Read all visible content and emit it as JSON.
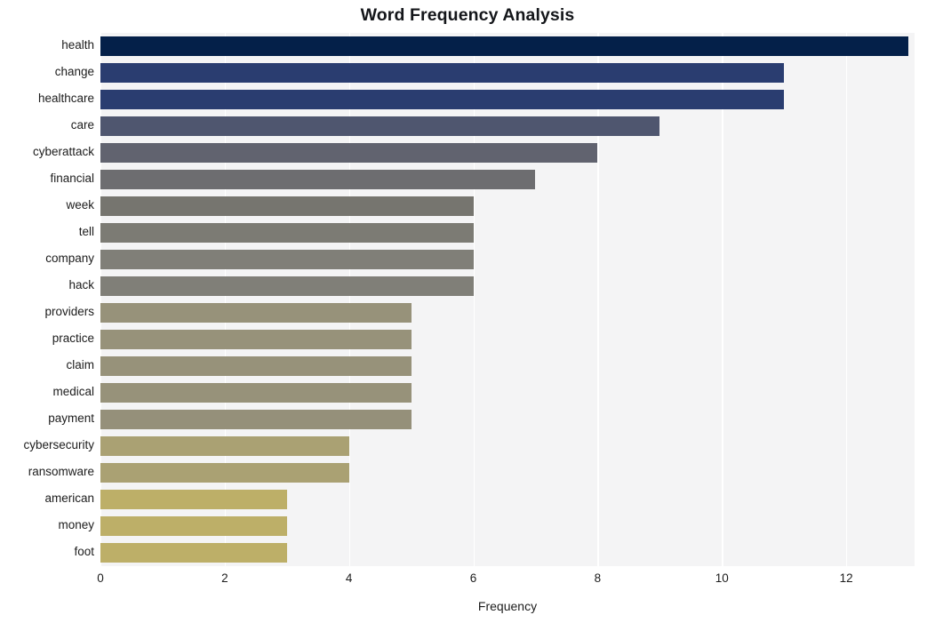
{
  "chart_data": {
    "type": "bar",
    "orientation": "horizontal",
    "title": "Word Frequency Analysis",
    "xlabel": "Frequency",
    "ylabel": "",
    "xlim": [
      0,
      13.1
    ],
    "xticks": [
      "0",
      "2",
      "4",
      "6",
      "8",
      "10",
      "12"
    ],
    "xtick_values": [
      0,
      2,
      4,
      6,
      8,
      10,
      12
    ],
    "grid": "vertical-white-on-light-gray",
    "legend": "none",
    "categories": [
      "health",
      "change",
      "healthcare",
      "care",
      "cyberattack",
      "financial",
      "week",
      "tell",
      "company",
      "hack",
      "providers",
      "practice",
      "claim",
      "medical",
      "payment",
      "cybersecurity",
      "ransomware",
      "american",
      "money",
      "foot"
    ],
    "values": [
      13,
      11,
      11,
      9,
      8,
      7,
      6,
      6,
      6,
      6,
      5,
      5,
      5,
      5,
      5,
      4,
      4,
      3,
      3,
      3
    ],
    "bar_colors": [
      "#042049",
      "#2a3d70",
      "#2a3d70",
      "#4f566f",
      "#61636f",
      "#6d6d70",
      "#76756f",
      "#7c7b74",
      "#807f78",
      "#807f78",
      "#97927a",
      "#97927a",
      "#97927a",
      "#97927a",
      "#95907a",
      "#aaa173",
      "#aaa173",
      "#bdaf68",
      "#bdaf68",
      "#bdaf68"
    ]
  },
  "figure": {
    "background": "#ffffff",
    "plot_background": "#f4f4f5",
    "gridline_color": "#ffffff",
    "text_color": "#1c1c1c",
    "title_color": "#14161a"
  }
}
